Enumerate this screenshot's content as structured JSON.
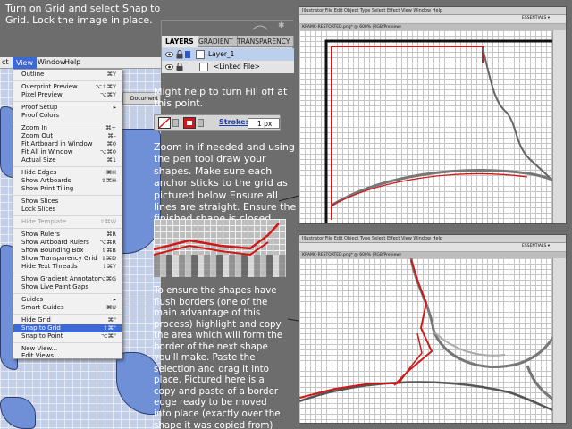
{
  "notes": {
    "top": "Turn on Grid and select Snap to Grid. Lock the image in place.",
    "fill": "Might help to turn Fill off at this point.",
    "zoom": "Zoom in if needed and using the pen tool draw your shapes. Make sure each anchor sticks to the grid as pictured below Ensure all lines are straight. Ensure the finished shape is closed.",
    "flush": "To ensure the shapes have flush borders (one of the main advantage of this process) highlight and copy the area which will form the border of the next shape you'll make. Paste the selection and drag it into place. Pictured here is a copy and paste of a border edge ready to be moved into place (exactly over the shape it was copied from)"
  },
  "menubar": {
    "left": "ct",
    "view": "View",
    "window": "Window",
    "help": "Help"
  },
  "menu": {
    "items": [
      {
        "label": "Outline",
        "shortcut": "⌘Y"
      },
      {
        "label": "Overprint Preview",
        "shortcut": "⌥⇧⌘Y"
      },
      {
        "label": "Pixel Preview",
        "shortcut": "⌥⌘Y"
      },
      {
        "label": "Proof Setup",
        "shortcut": "▸"
      },
      {
        "label": "Proof Colors",
        "shortcut": ""
      },
      {
        "label": "Zoom In",
        "shortcut": "⌘+"
      },
      {
        "label": "Zoom Out",
        "shortcut": "⌘–"
      },
      {
        "label": "Fit Artboard in Window",
        "shortcut": "⌘0"
      },
      {
        "label": "Fit All in Window",
        "shortcut": "⌥⌘0"
      },
      {
        "label": "Actual Size",
        "shortcut": "⌘1"
      },
      {
        "label": "Hide Edges",
        "shortcut": "⌘H"
      },
      {
        "label": "Show Artboards",
        "shortcut": "⇧⌘H"
      },
      {
        "label": "Show Print Tiling",
        "shortcut": ""
      },
      {
        "label": "Show Slices",
        "shortcut": ""
      },
      {
        "label": "Lock Slices",
        "shortcut": ""
      },
      {
        "label": "Hide Template",
        "shortcut": "⇧⌘W"
      },
      {
        "label": "Show Rulers",
        "shortcut": "⌘R"
      },
      {
        "label": "Show Artboard Rulers",
        "shortcut": "⌥⌘R"
      },
      {
        "label": "Show Bounding Box",
        "shortcut": "⇧⌘B"
      },
      {
        "label": "Show Transparency Grid",
        "shortcut": "⇧⌘D"
      },
      {
        "label": "Hide Text Threads",
        "shortcut": "⇧⌘Y"
      },
      {
        "label": "Show Gradient Annotator",
        "shortcut": "⌥⌘G"
      },
      {
        "label": "Show Live Paint Gaps",
        "shortcut": ""
      },
      {
        "label": "Guides",
        "shortcut": "▸"
      },
      {
        "label": "Smart Guides",
        "shortcut": "⌘U"
      },
      {
        "label": "Hide Grid",
        "shortcut": "⌘\""
      },
      {
        "label": "Snap to Grid",
        "shortcut": "⇧⌘\""
      },
      {
        "label": "Snap to Point",
        "shortcut": "⌥⌘\""
      },
      {
        "label": "New View...",
        "shortcut": ""
      },
      {
        "label": "Edit Views...",
        "shortcut": ""
      }
    ]
  },
  "strip": {
    "label": "Document"
  },
  "layers_panel": {
    "tabs": [
      "LAYERS",
      "GRADIENT",
      "TRANSPARENCY"
    ],
    "layer_name": "Layer_1",
    "sublayer_name": "<Linked File>"
  },
  "stroke_bar": {
    "label": "Stroke:",
    "value": "1 px"
  },
  "screen1": {
    "menus": "Illustrator  File  Edit  Object  Type  Select  Effect  View  Window  Help",
    "tab": "KRAMC-RESTORTED.png* @ 600% (RGB/Preview)",
    "workspace": "ESSENTIALS ▾"
  },
  "screen2": {
    "menus": "Illustrator  File  Edit  Object  Type  Select  Effect  View  Window  Help",
    "tab": "KRAMC-RESTORTED.png* @ 600% (RGB/Preview)",
    "workspace": "ESSENTIALS ▾"
  },
  "colors": {
    "highlight": "#3d68d8",
    "stroke_red": "#d01818",
    "background": "#6d6d6d"
  }
}
